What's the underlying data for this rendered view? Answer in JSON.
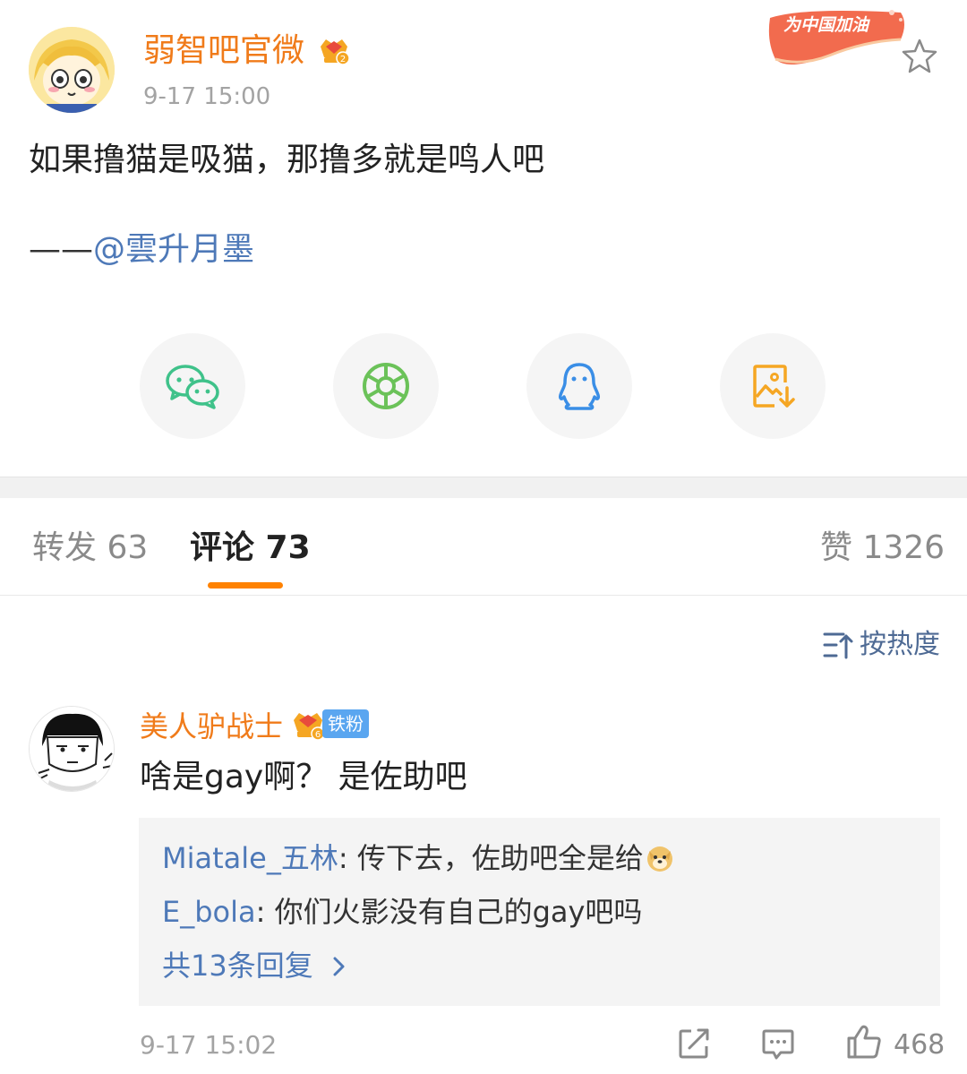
{
  "post": {
    "author": "弱智吧官微",
    "time": "9-17 15:00",
    "campaign_badge": "为中国加油",
    "text": "如果撸猫是吸猫，那撸多就是鸣人吧",
    "sign_dash": "——",
    "sign_mention": "@雲升月墨"
  },
  "share": [
    {
      "name": "wechat-icon",
      "color": "#3fc28a"
    },
    {
      "name": "moments-icon",
      "color": "#6bc259"
    },
    {
      "name": "qq-icon",
      "color": "#3a8ee6"
    },
    {
      "name": "save-image-icon",
      "color": "#f5a623"
    }
  ],
  "tabs": {
    "repost": "转发 63",
    "comments": "评论 73",
    "likes": "赞 1326"
  },
  "sort": {
    "label": "按热度"
  },
  "comment": {
    "author": "美人驴战士",
    "vip_level": "6",
    "fan_badge": "铁粉",
    "text": "啥是gay啊？  是佐助吧",
    "replies": [
      {
        "user": "Miatale_五林",
        "sep": ": ",
        "text": "传下去，佐助吧全是给"
      },
      {
        "user": "E_bola",
        "sep": ": ",
        "text": "你们火影没有自己的gay吧吗"
      }
    ],
    "more_replies": "共13条回复",
    "time": "9-17 15:02",
    "like_count": "468"
  },
  "colors": {
    "accent": "#ff8200",
    "author_orange": "#f07b1a",
    "link_blue": "#4e79b8"
  }
}
